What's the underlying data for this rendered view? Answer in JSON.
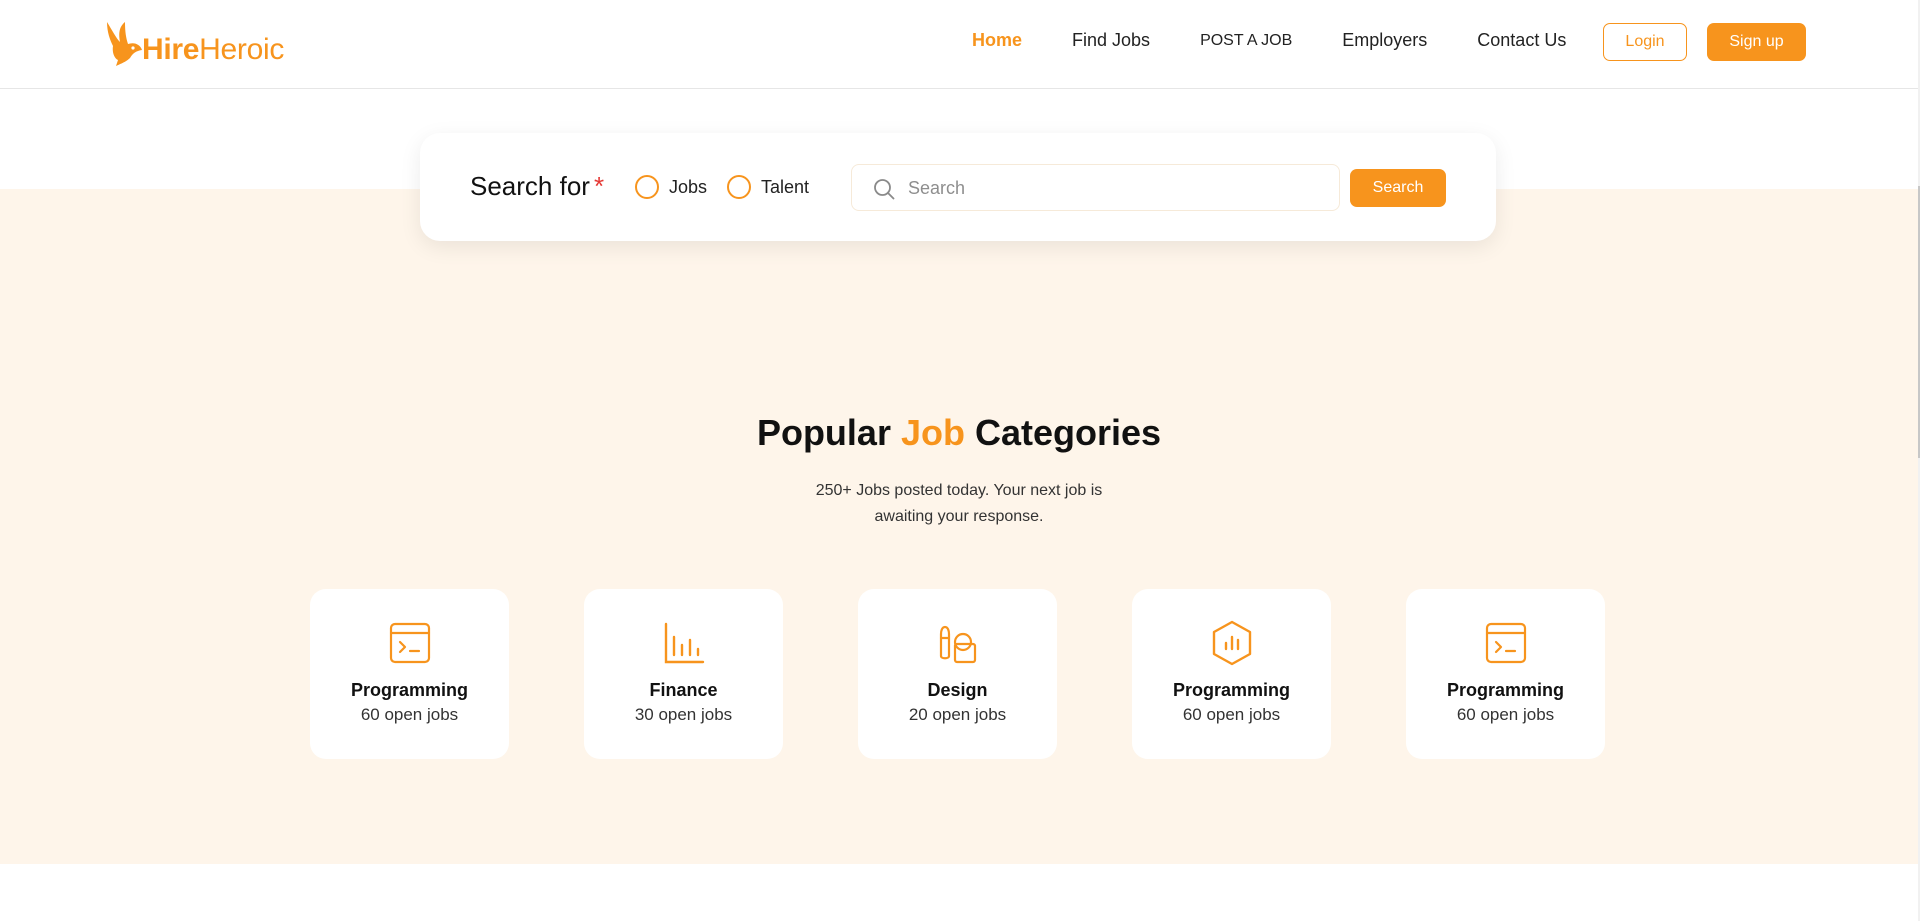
{
  "brand": {
    "hire": "Hire",
    "heroic": "Heroic",
    "color": "#f7941d"
  },
  "nav": {
    "items": [
      {
        "label": "Home",
        "active": true
      },
      {
        "label": "Find Jobs",
        "active": false
      },
      {
        "label": "POST A JOB",
        "active": false
      },
      {
        "label": "Employers",
        "active": false
      },
      {
        "label": "Contact Us",
        "active": false
      }
    ],
    "login": "Login",
    "signup": "Sign up"
  },
  "search": {
    "label": "Search for",
    "required_mark": "*",
    "options": [
      {
        "label": "Jobs",
        "selected": false
      },
      {
        "label": "Talent",
        "selected": false
      }
    ],
    "placeholder": "Search",
    "value": "",
    "button": "Search"
  },
  "categories_section": {
    "title_pre": "Popular ",
    "title_accent": "Job",
    "title_post": " Categories",
    "subtitle_line1": "250+ Jobs posted today. Your next job is",
    "subtitle_line2": "awaiting your response.",
    "cards": [
      {
        "name": "Programming",
        "count": "60 open jobs",
        "icon": "terminal-window-icon"
      },
      {
        "name": "Finance",
        "count": "30 open jobs",
        "icon": "bar-chart-icon"
      },
      {
        "name": "Design",
        "count": "20 open jobs",
        "icon": "design-tools-icon"
      },
      {
        "name": "Programming",
        "count": "60 open jobs",
        "icon": "hexagon-chart-icon"
      },
      {
        "name": "Programming",
        "count": "60 open jobs",
        "icon": "terminal-window-icon"
      }
    ]
  },
  "colors": {
    "accent": "#f7941d",
    "band": "#fef5ea",
    "required": "#e53935"
  }
}
